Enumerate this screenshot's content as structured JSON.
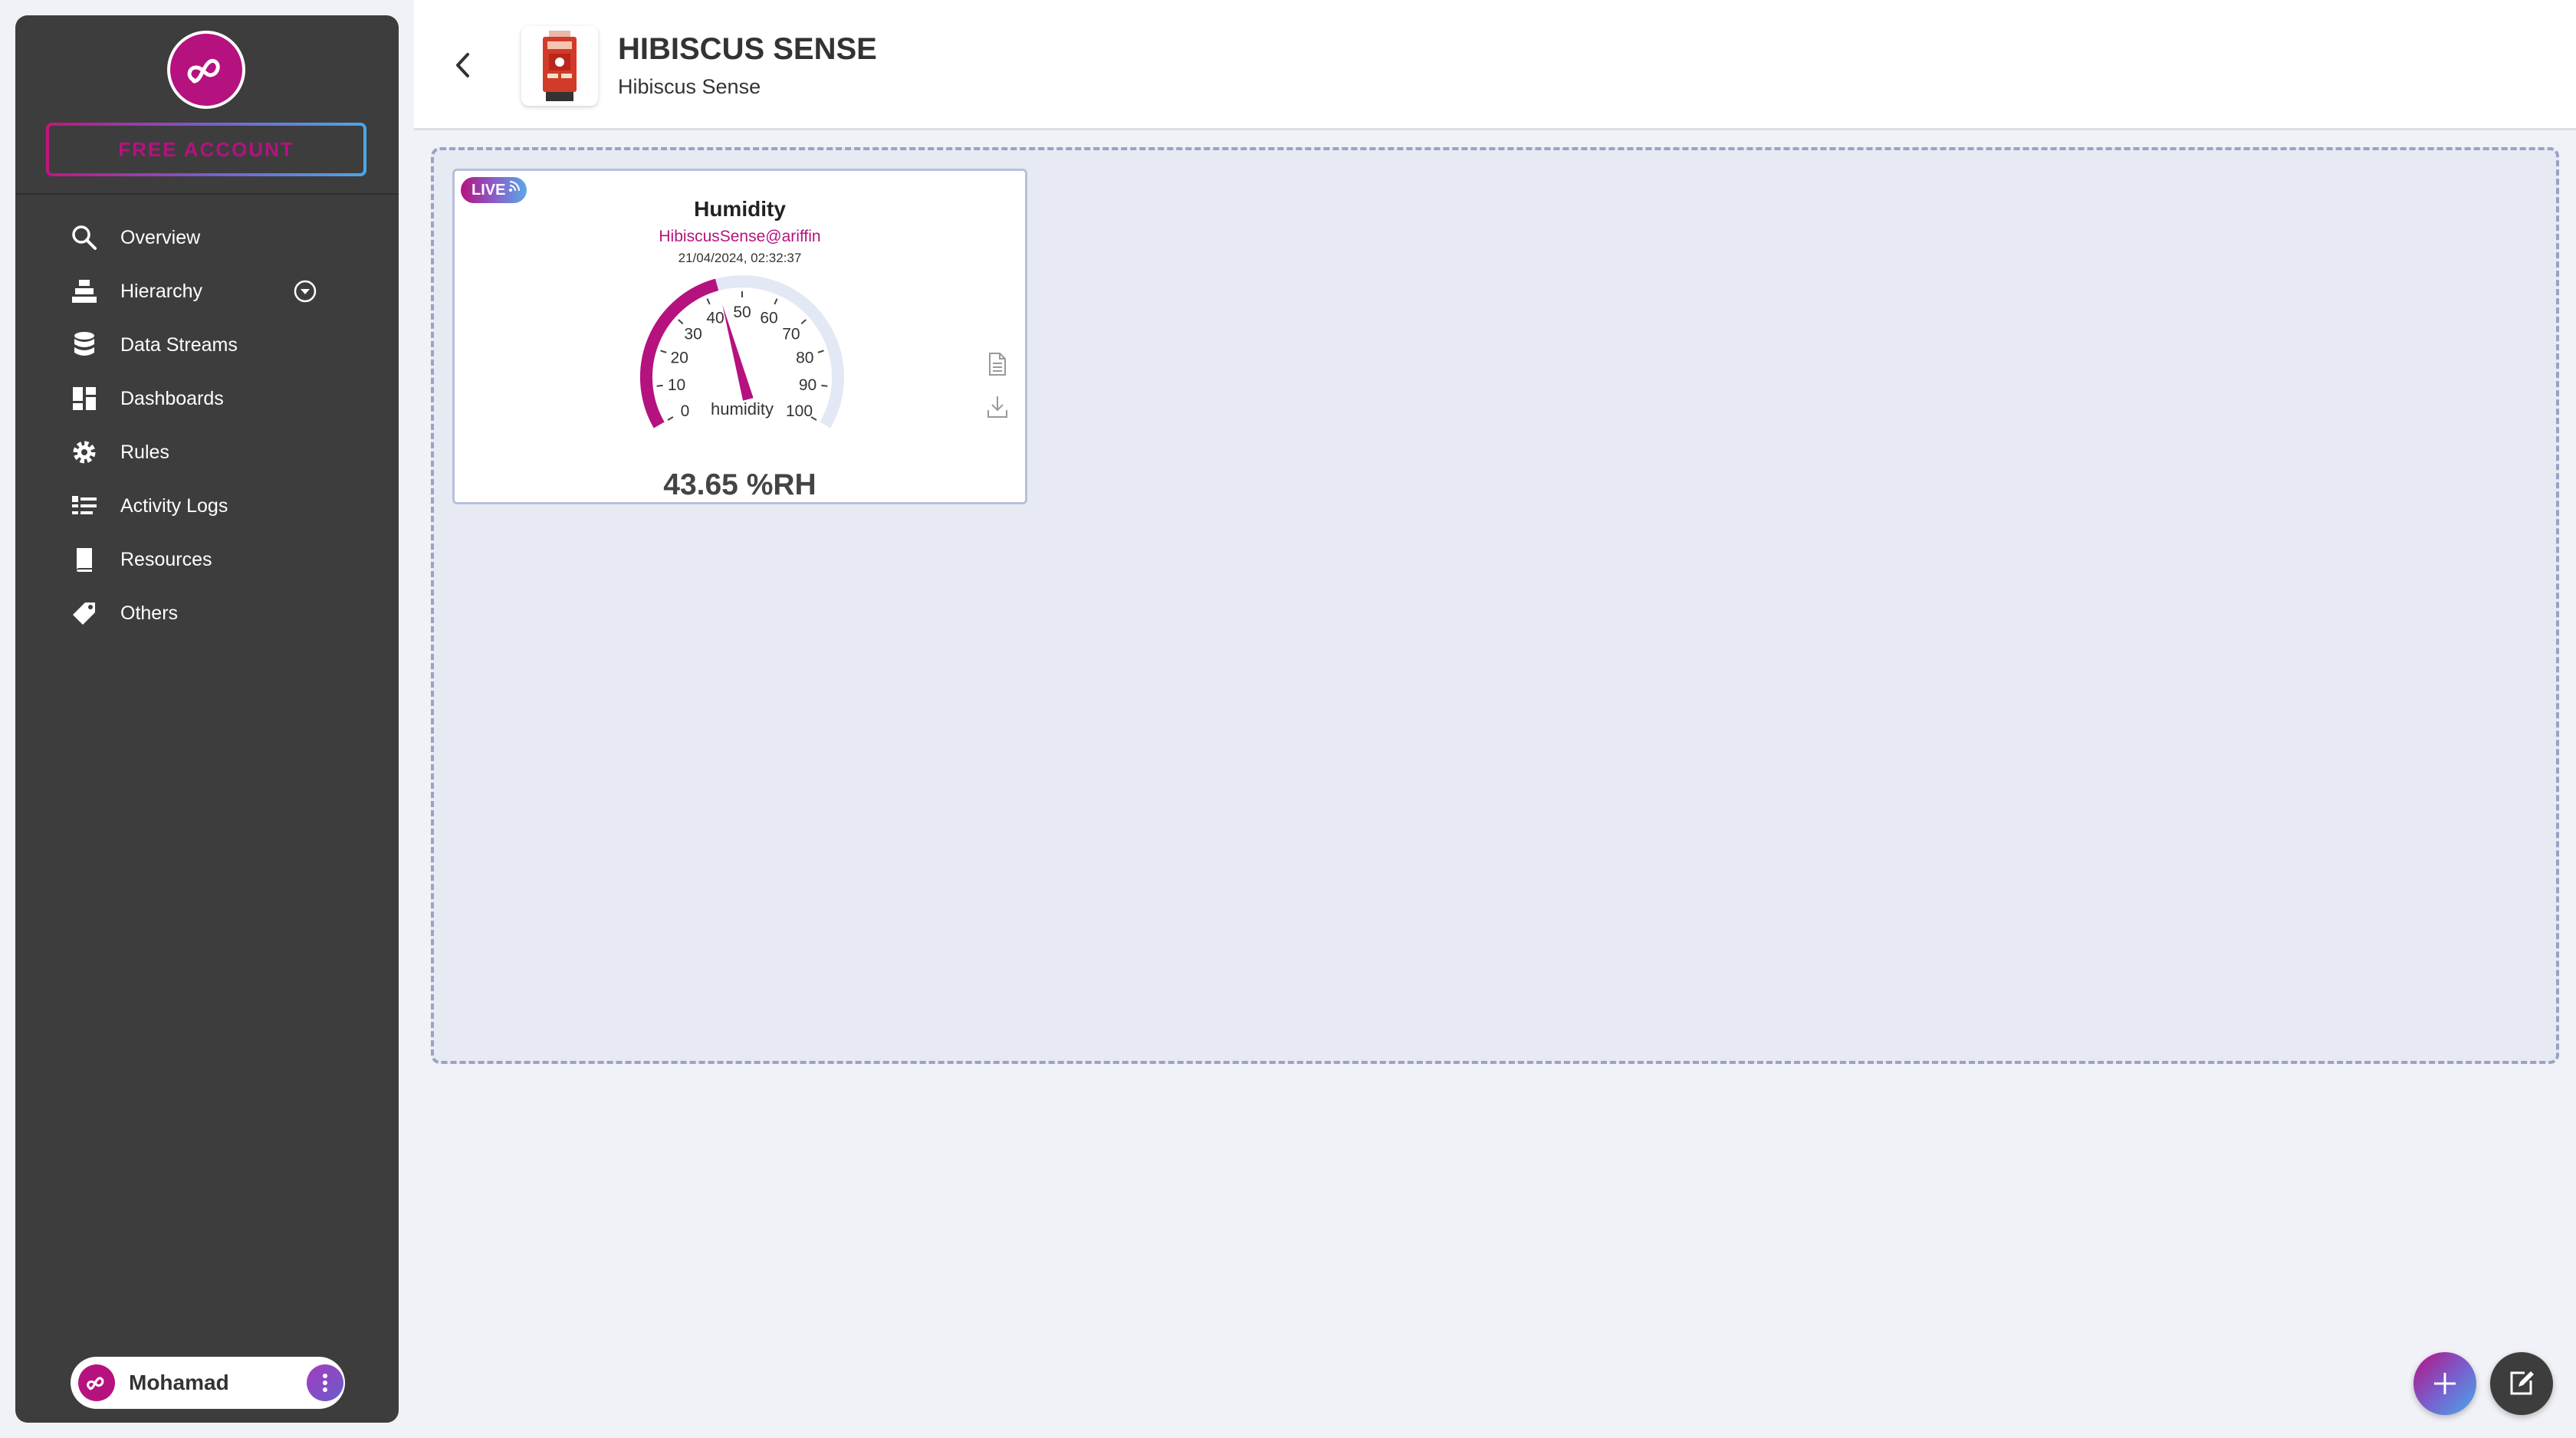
{
  "sidebar": {
    "account_button": "FREE ACCOUNT",
    "items": [
      {
        "label": "Overview",
        "icon": "search-icon"
      },
      {
        "label": "Hierarchy",
        "icon": "hierarchy-icon"
      },
      {
        "label": "Data Streams",
        "icon": "database-icon"
      },
      {
        "label": "Dashboards",
        "icon": "dashboard-icon"
      },
      {
        "label": "Rules",
        "icon": "gear-icon"
      },
      {
        "label": "Activity Logs",
        "icon": "list-icon"
      },
      {
        "label": "Resources",
        "icon": "book-icon"
      },
      {
        "label": "Others",
        "icon": "tag-icon"
      }
    ],
    "user": {
      "name": "Mohamad"
    }
  },
  "header": {
    "title": "HIBISCUS SENSE",
    "subtitle": "Hibiscus Sense"
  },
  "widget": {
    "badge": "LIVE",
    "title": "Humidity",
    "source": "HibiscusSense@ariffin",
    "timestamp": "21/04/2024, 02:32:37",
    "gauge_label": "humidity",
    "gauge_value": 43.65,
    "gauge_min": 0,
    "gauge_max": 100,
    "gauge_ticks": [
      "0",
      "10",
      "20",
      "30",
      "40",
      "50",
      "60",
      "70",
      "80",
      "90",
      "100"
    ],
    "value_text": "43.65 %RH"
  },
  "colors": {
    "brand": "#b5127f",
    "sidebar_bg": "#3d3d3d",
    "canvas_bg": "#e7eaf2",
    "gauge_track": "#e3e8f5"
  }
}
